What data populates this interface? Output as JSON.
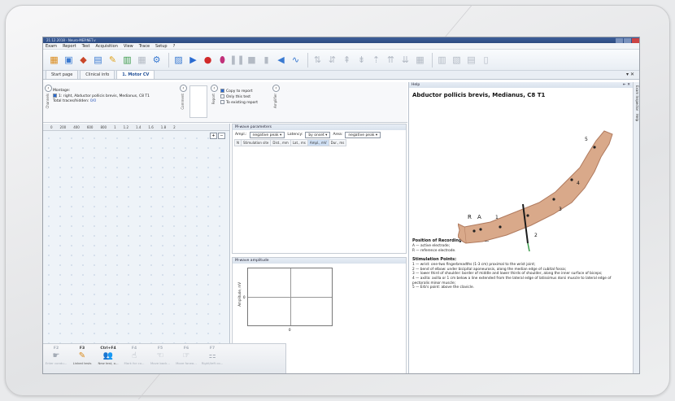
{
  "app": {
    "title": "21.12.2018 - Neuro-MEP.NET.v"
  },
  "menu": [
    "Exam",
    "Report",
    "Test",
    "Acquisition",
    "View",
    "Trace",
    "Setup",
    "?"
  ],
  "tabs": [
    {
      "label": "Start page"
    },
    {
      "label": "Clinical info"
    },
    {
      "label": "1. Motor CV"
    }
  ],
  "montage": {
    "caption": "Montage:",
    "item": "1: right, Abductor pollicis brevis, Medianus, C8 T1",
    "traces_label": "Total traces/hidden:",
    "traces_value": "0/0",
    "side_label": "Channels",
    "comment_label": "Comment"
  },
  "report": {
    "side_label": "Report",
    "copy": "Copy to report",
    "only_this": "Only this test",
    "existing": "To existing report",
    "amplifier_label": "Amplifier"
  },
  "ruler": [
    "0",
    "200",
    "400",
    "600",
    "800",
    "1",
    "1.2",
    "1.4",
    "1.6",
    "1.8",
    "2"
  ],
  "mwave": {
    "title": "M-wave parameters",
    "ampl_label": "Ampl.:",
    "ampl_value": "negative peak",
    "latency_label": "Latency:",
    "latency_value": "by onset",
    "area_label": "Area:",
    "area_value": "negative peak",
    "columns": [
      "N",
      "Stimulation site",
      "Dist., mm",
      "Lat., ms",
      "Ampl., mV",
      "Dur., ms"
    ]
  },
  "amplitude": {
    "title": "M-wave amplitude",
    "ylabel": "Amplitude, mV",
    "zero_y": "0",
    "zero_x": "0"
  },
  "help": {
    "bar": "Help",
    "heading": "Abductor pollicis brevis, Medianus, C8 T1",
    "recording_title": "Position of Recording Electrodes:",
    "recording_a": "A — active electrode;",
    "recording_r": "R — reference electrode.",
    "stim_title": "Stimulation Points:",
    "stim_1": "1 — wrist: one-two fingerbreadths (1-3 cm) proximal to the wrist joint;",
    "stim_2": "2 — bend of elbow: under bicipital aponeurosis, along the median edge of cubital fossa;",
    "stim_3": "3 — lower third of shoulder: border of middle and lower thirds of shoulder, along the inner surface of biceps;",
    "stim_4": "4 — axilla: axilla or 1 cm below a line extended from the lateral edge of latissimus dorsi muscle to lateral edge of pectoralis minor muscle;",
    "stim_5": "5 — Erb's point: above the clavicle.",
    "img_labels": {
      "r": "R",
      "a": "A",
      "p1": "1",
      "p2": "2",
      "p3": "3",
      "p4": "4",
      "p5": "5"
    }
  },
  "side_tabs": [
    "Exam Inspector",
    "Help"
  ],
  "fkeys": [
    {
      "key": "F2",
      "label": "Enter condu...",
      "icon": "☛",
      "enabled": false
    },
    {
      "key": "F3",
      "label": "Linked tests",
      "icon": "✎",
      "enabled": true
    },
    {
      "key": "Ctrl+F4",
      "label": "New test, o...",
      "icon": "👥",
      "enabled": true
    },
    {
      "key": "F4",
      "label": "Mark for co...",
      "icon": "☝",
      "enabled": false
    },
    {
      "key": "F5",
      "label": "Move back...",
      "icon": "☜",
      "enabled": false
    },
    {
      "key": "F6",
      "label": "Move forwa...",
      "icon": "☞",
      "enabled": false
    },
    {
      "key": "F7",
      "label": "Right/left co...",
      "icon": "⚏",
      "enabled": false
    }
  ],
  "colors": {
    "accent": "#2a55b8",
    "title_bar": "#2c4a80"
  }
}
